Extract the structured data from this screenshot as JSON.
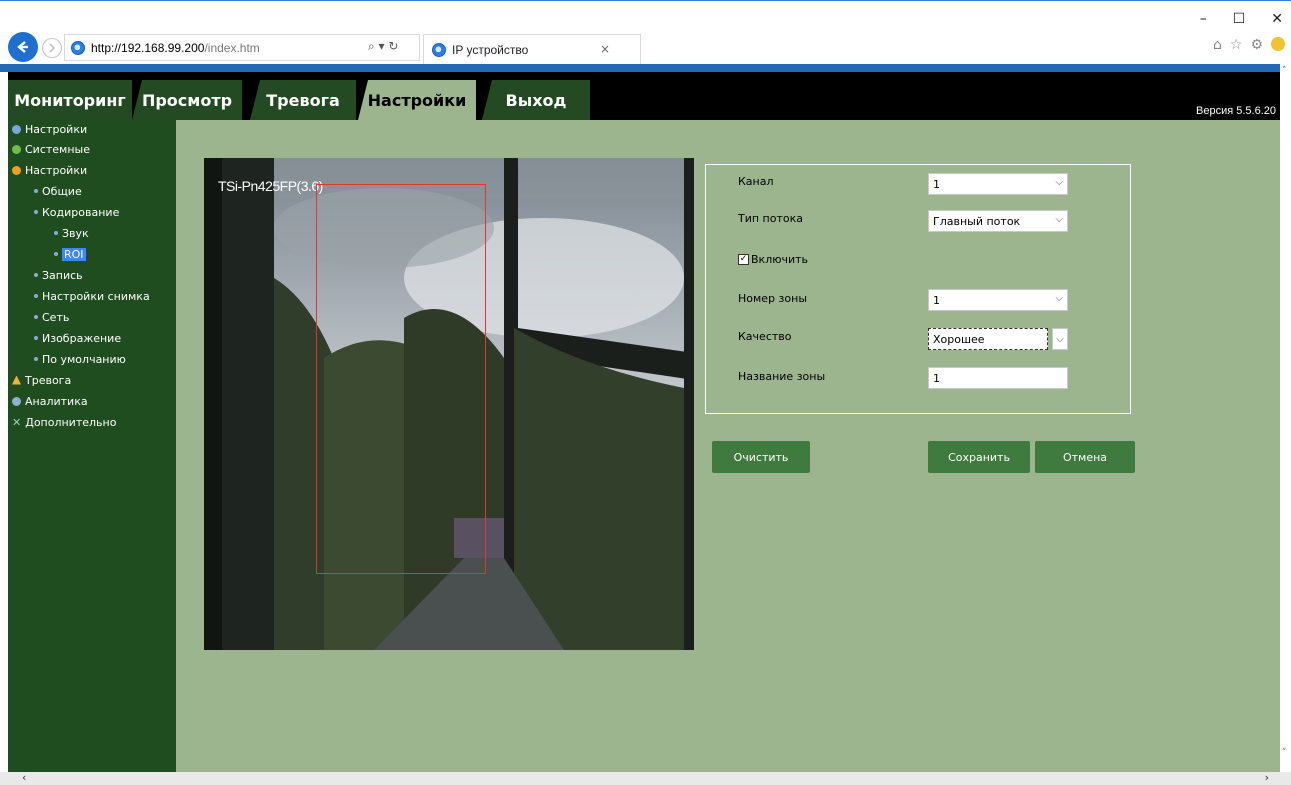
{
  "browser": {
    "url_host": "http://192.168.99.200",
    "url_path": "/index.htm",
    "search_refresh": "⌕ ▾ ↻",
    "tab_title": "IP устройство",
    "tab_close": "×"
  },
  "app": {
    "nav": [
      "Мониторинг",
      "Просмотр",
      "Тревога",
      "Настройки",
      "Выход"
    ],
    "active_nav": "Настройки",
    "version": "Версия 5.5.6.20"
  },
  "sidebar": {
    "items": [
      {
        "label": "Настройки",
        "icon": "settings-icon"
      },
      {
        "label": "Системные",
        "icon": "system-icon"
      },
      {
        "label": "Настройки",
        "icon": "gear-icon"
      },
      {
        "label": "Общие"
      },
      {
        "label": "Кодирование"
      },
      {
        "label": "Звук"
      },
      {
        "label": "ROI",
        "selected": true
      },
      {
        "label": "Запись"
      },
      {
        "label": "Настройки снимка"
      },
      {
        "label": "Сеть"
      },
      {
        "label": "Изображение"
      },
      {
        "label": "По умолчанию"
      },
      {
        "label": "Тревога",
        "icon": "alarm-icon"
      },
      {
        "label": "Аналитика",
        "icon": "analytics-icon"
      },
      {
        "label": "Дополнительно",
        "icon": "extra-icon"
      }
    ]
  },
  "video": {
    "overlay_label": "TSi-Pn425FP(3.6)"
  },
  "form": {
    "channel_label": "Канал",
    "channel_value": "1",
    "stream_label": "Тип потока",
    "stream_value": "Главный поток",
    "enable_label": "Включить",
    "enable_checked": true,
    "zone_number_label": "Номер зоны",
    "zone_number_value": "1",
    "quality_label": "Качество",
    "quality_value": "Хорошее",
    "zone_name_label": "Название зоны",
    "zone_name_value": "1"
  },
  "buttons": {
    "clear": "Очистить",
    "save": "Сохранить",
    "cancel": "Отмена"
  },
  "colors": {
    "main_bg": "#9db58f",
    "sidebar_bg": "#1f4d1f",
    "button_bg": "#3f7b3f",
    "roi_border": "#e43535",
    "selected_item": "#3a88ff"
  }
}
